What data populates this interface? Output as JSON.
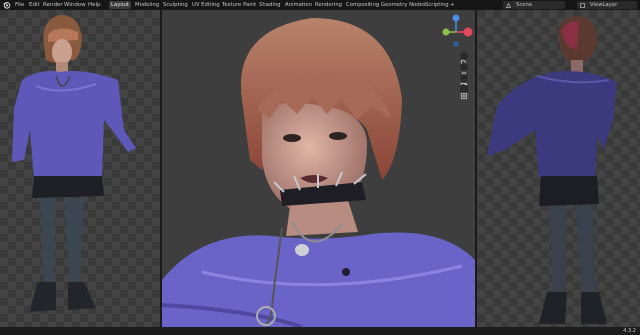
{
  "menu": {
    "items": [
      "File",
      "Edit",
      "Render",
      "Window",
      "Help"
    ]
  },
  "workspaces": {
    "tabs": [
      "Layout",
      "Modeling",
      "Sculpting",
      "UV Editing",
      "Texture Paint",
      "Shading",
      "Animation",
      "Rendering",
      "Compositing",
      "Geometry Nodes",
      "Scripting"
    ],
    "active": "Layout",
    "add_symbol": "+"
  },
  "scene": {
    "label": "Scene"
  },
  "view_layer": {
    "label": "ViewLayer"
  },
  "gizmo": {
    "axis_x": "X",
    "axis_y": "Y",
    "axis_z": "Z",
    "colors": {
      "x": "#e2475a",
      "y": "#8bc34a",
      "z": "#4a8fe2"
    }
  },
  "status": {
    "version": "4.3.2"
  },
  "viewports": {
    "left": {
      "view": "front-full-body"
    },
    "center": {
      "view": "face-closeup"
    },
    "right": {
      "view": "back-full-body"
    }
  },
  "colors": {
    "sweater": "#6a64c9",
    "hair": "#b06a4a",
    "background": "#3a3a3a"
  }
}
